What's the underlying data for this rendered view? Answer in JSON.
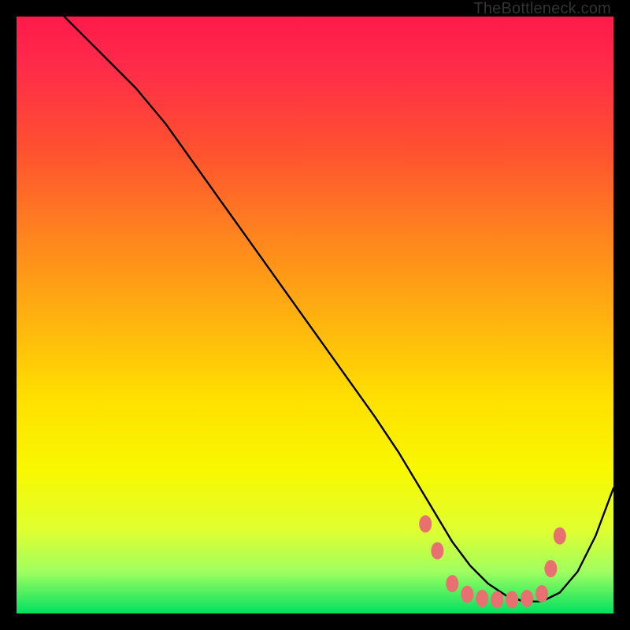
{
  "watermark": "TheBottleneck.com",
  "chart_data": {
    "type": "line",
    "title": "",
    "xlabel": "",
    "ylabel": "",
    "xlim": [
      0,
      100
    ],
    "ylim": [
      0,
      100
    ],
    "series": [
      {
        "name": "curve",
        "x": [
          8,
          12,
          16,
          20,
          25,
          30,
          35,
          40,
          45,
          50,
          55,
          60,
          64,
          67,
          70,
          73,
          76,
          79,
          82,
          85,
          88,
          91,
          94,
          97,
          100
        ],
        "y": [
          100,
          96,
          92,
          88,
          82,
          75,
          68,
          61,
          54,
          47,
          40,
          33,
          27,
          22,
          17,
          12,
          8,
          5,
          3,
          2,
          2,
          3.5,
          7,
          13,
          21
        ]
      }
    ],
    "markers": {
      "name": "dots",
      "color": "#e87070",
      "x": [
        68.5,
        70.5,
        73,
        75.5,
        78,
        80.5,
        83,
        85.5,
        88,
        89.5,
        91
      ],
      "y": [
        15,
        10.5,
        5,
        3.2,
        2.5,
        2.3,
        2.3,
        2.5,
        3.3,
        7.5,
        13
      ]
    }
  }
}
